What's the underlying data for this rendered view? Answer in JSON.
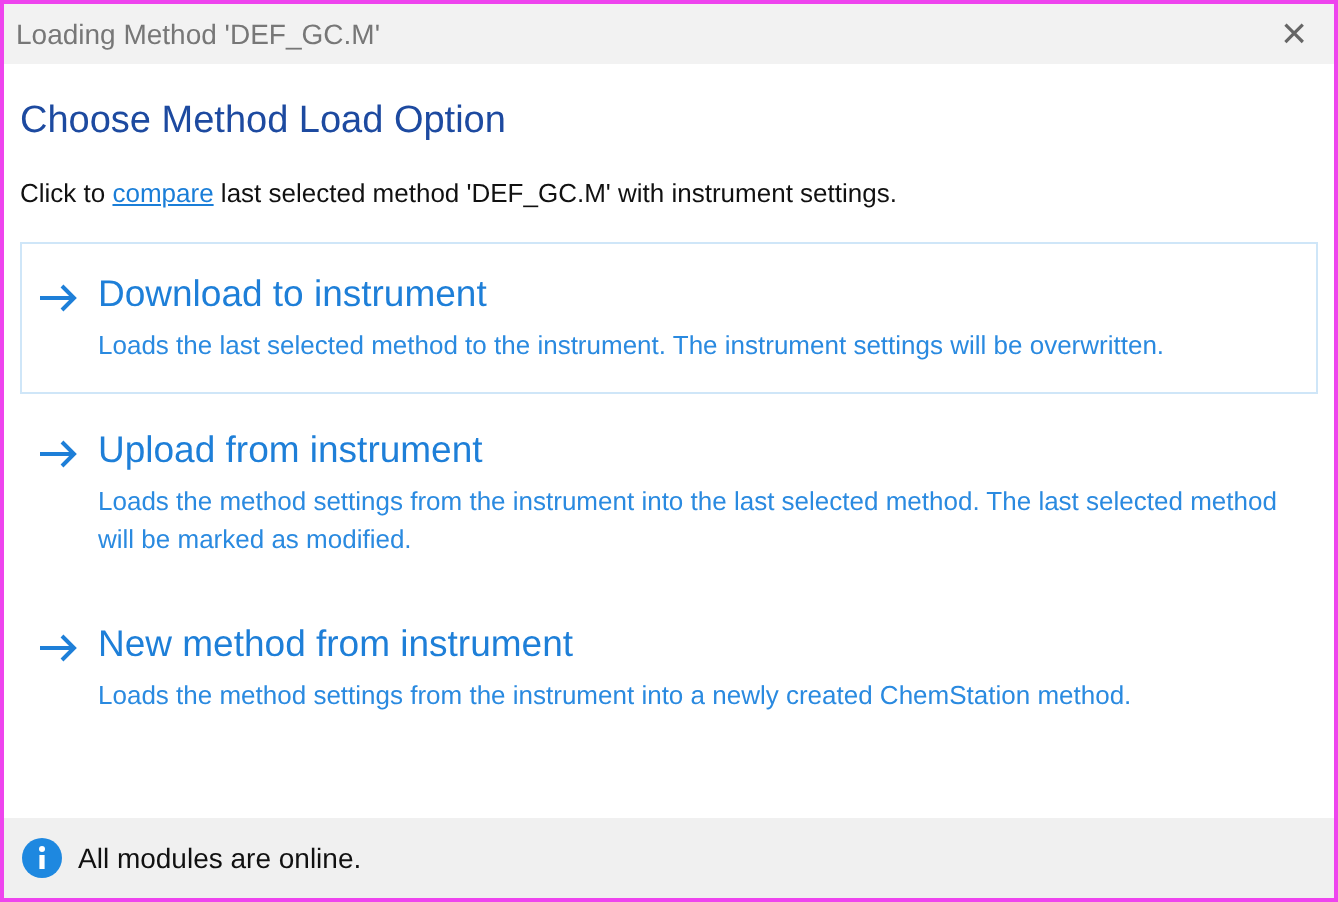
{
  "window": {
    "title": "Loading Method 'DEF_GC.M'",
    "close": "×"
  },
  "heading": "Choose Method Load Option",
  "intro": {
    "before": "Click to ",
    "link": "compare",
    "after": " last selected method 'DEF_GC.M' with instrument settings."
  },
  "options": [
    {
      "title": "Download to instrument",
      "description": "Loads the last selected method to the instrument. The instrument settings will be overwritten.",
      "selected": true
    },
    {
      "title": "Upload from instrument",
      "description": "Loads the method settings from the instrument into the last selected method. The last selected method will be marked as modified.",
      "selected": false
    },
    {
      "title": "New method from instrument",
      "description": "Loads the method settings from the instrument into a newly created ChemStation method.",
      "selected": false
    }
  ],
  "status_bar": {
    "message": "All modules are online."
  }
}
